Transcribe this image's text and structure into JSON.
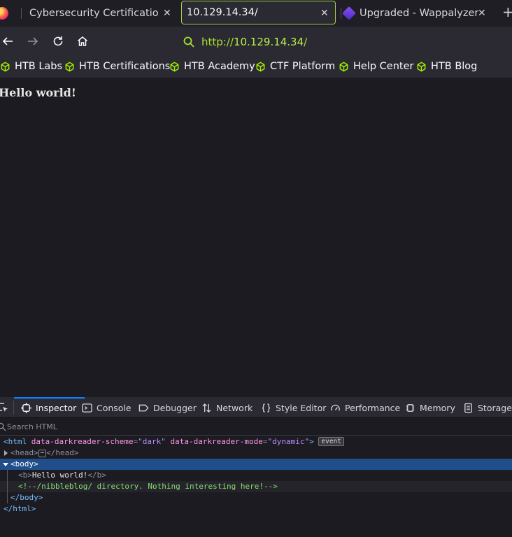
{
  "tabs": [
    {
      "title": "Cybersecurity Certifications |",
      "active": false
    },
    {
      "title": "10.129.14.34/",
      "active": true
    },
    {
      "title": "Upgraded - Wappalyzer",
      "active": false
    }
  ],
  "new_tab_label": "+",
  "address_bar": {
    "scheme": "http://",
    "host": "10.129.14.34",
    "path": "/"
  },
  "bookmarks": [
    {
      "label": "HTB Labs"
    },
    {
      "label": "HTB Certifications"
    },
    {
      "label": "HTB Academy"
    },
    {
      "label": "CTF Platform"
    },
    {
      "label": "Help Center"
    },
    {
      "label": "HTB Blog"
    }
  ],
  "page": {
    "heading": "Hello world!"
  },
  "devtools": {
    "tabs": [
      {
        "label": "Inspector"
      },
      {
        "label": "Console"
      },
      {
        "label": "Debugger"
      },
      {
        "label": "Network"
      },
      {
        "label": "Style Editor"
      },
      {
        "label": "Performance"
      },
      {
        "label": "Memory"
      },
      {
        "label": "Storage"
      }
    ],
    "search_placeholder": "Search HTML",
    "markup": {
      "html_open": "<html",
      "attr1_name": "data-darkreader-scheme",
      "attr1_value": "\"dark\"",
      "attr2_name": "data-darkreader-mode",
      "attr2_value": "\"dynamic\"",
      "html_open_end": ">",
      "event_badge": "event",
      "head_open": "<head>",
      "head_ellipsis": "⋯",
      "head_close": "</head>",
      "body_open": "<body>",
      "b_open": "<b>",
      "b_text": "Hello world!",
      "b_close": "</b>",
      "comment": "<!--/nibbleblog/ directory. Nothing interesting here!-->",
      "body_close": "</body>",
      "html_close": "</html>"
    }
  },
  "colors": {
    "accent": "#a1d04b",
    "selection": "#204e8a",
    "devtools_active": "#0a84ff"
  }
}
